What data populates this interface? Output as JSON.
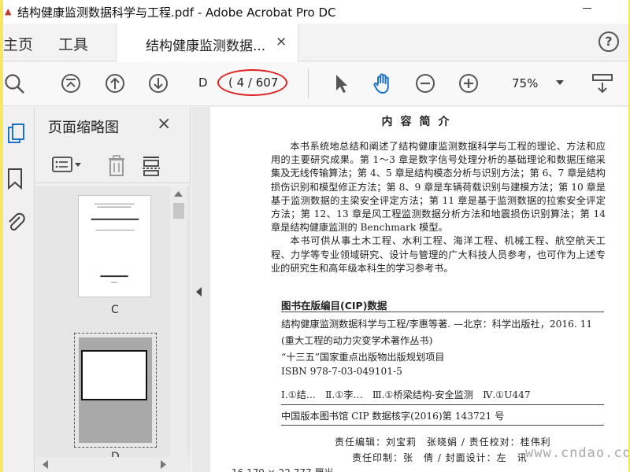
{
  "window": {
    "title": "结构健康监测数据科学与工程.pdf - Adobe Acrobat Pro DC"
  },
  "tabs": {
    "home": "主页",
    "tools": "工具",
    "document": "结构健康监测数据...",
    "close": "×",
    "help": "?"
  },
  "toolbar": {
    "page_input": "D",
    "page_count": "( 4 / 607",
    "zoom": "75%"
  },
  "thumbnails": {
    "title": "页面缩略图",
    "close": "×",
    "pages": [
      {
        "label": "C"
      },
      {
        "label": "D"
      }
    ]
  },
  "document": {
    "heading": "内容简介",
    "paragraphs": [
      "本书系统地总结和阐述了结构健康监测数据科学与工程的理论、方法和应用的主要研究成果。第 1～3 章是数字信号处理分析的基础理论和数据压缩采集及无线传输算法；第 4、5 章是结构模态分析与识别方法；第 6、7 章是结构损伤识别和模型修正方法；第 8、9 章是车辆荷载识别与建模方法；第 10 章是基于监测数据的主梁安全评定方法；第 11 章是基于监测数据的拉索安全评定方法；第 12、13 章是风工程监测数据分析方法和地震损伤识别算法；第 14 章是结构健康监测的 Benchmark 模型。",
      "本书可供从事土木工程、水利工程、海洋工程、机械工程、航空航天工程、力学等专业领域研究、设计与管理的广大科技人员参考，也可作为上述专业的研究生和高年级本科生的学习参考书。"
    ],
    "cip": {
      "heading": "图书在版编目(CIP)数据",
      "line1": "结构健康监测数据科学与工程/李惠等著. —北京：科学出版社，2016. 11",
      "line2": "(重大工程的动力灾变学术著作丛书)",
      "line3": "“十三五”国家重点出版物出版规划项目",
      "line4": "ISBN 978-7-03-049101-5",
      "line5": "Ⅰ.①结…　Ⅱ.①李…　Ⅲ.①桥梁结构-安全监测　Ⅳ.①U447",
      "line6": "中国版本图书馆 CIP 数据核字(2016)第 143721 号"
    },
    "credits_line1": "责任编辑：刘宝莉　张晓娟 / 责任校对：桂伟利",
    "credits_line2": "责任印制：张　倩 / 封面设计：左　讯",
    "status": "16.179 × 22.777 厘米"
  },
  "watermark": "www.cndao.com"
}
